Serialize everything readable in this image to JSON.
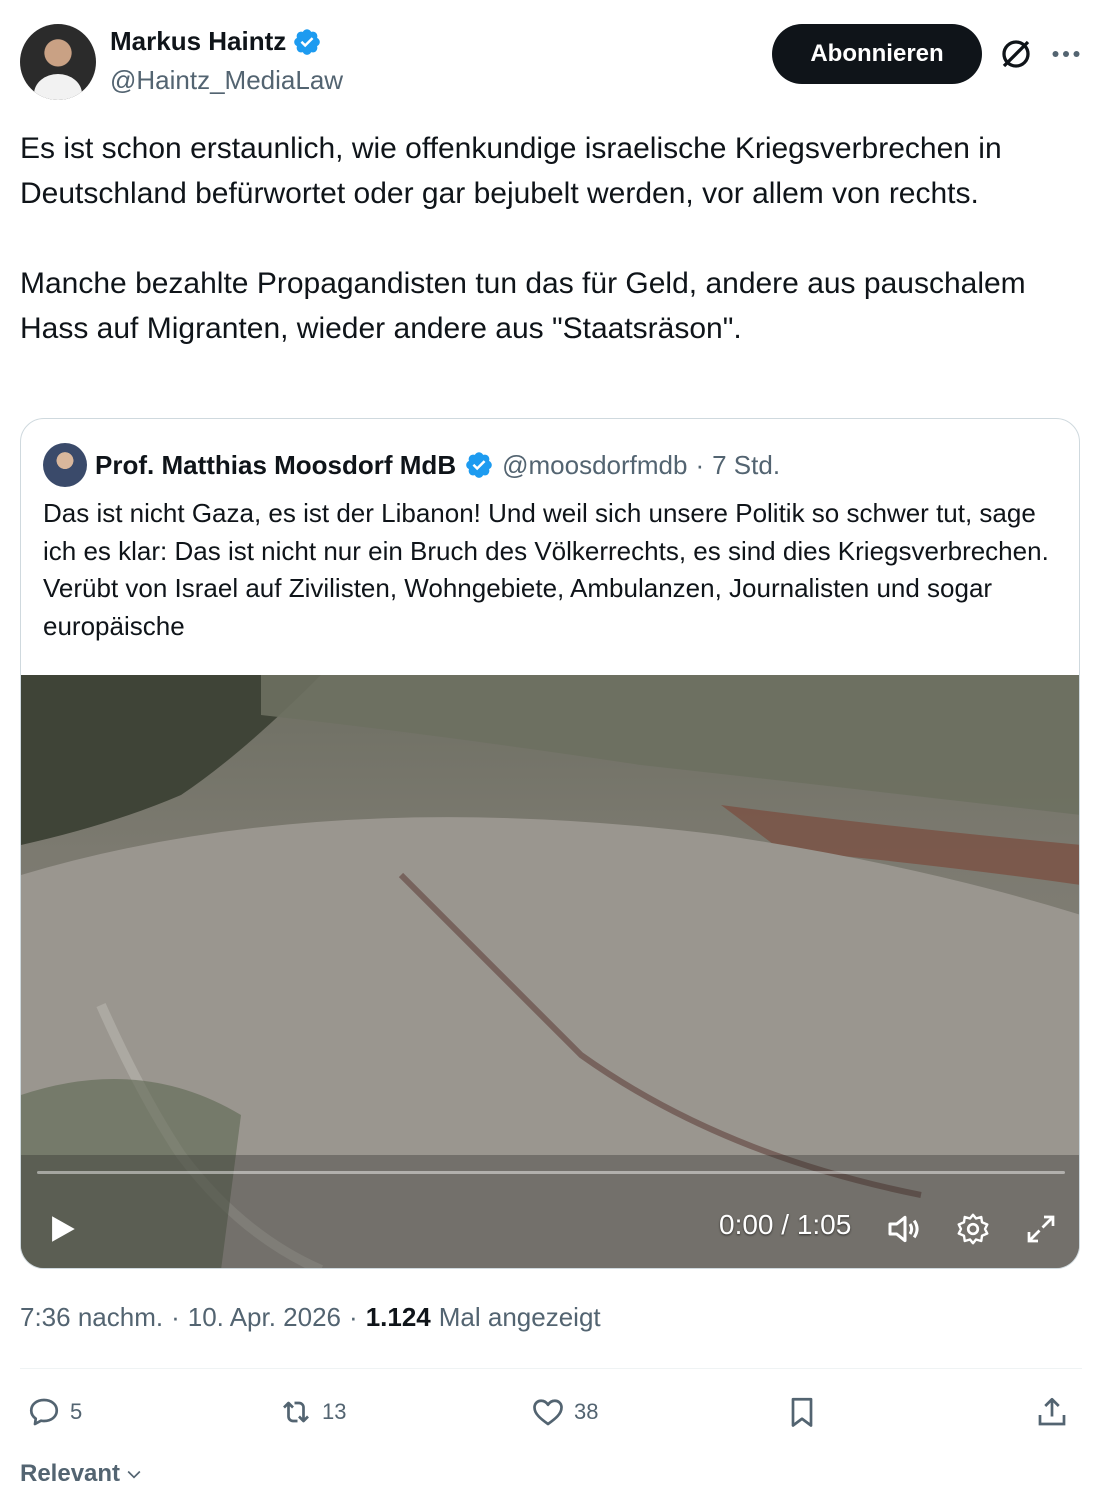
{
  "author": {
    "name": "Markus Haintz",
    "handle": "@Haintz_MediaLaw"
  },
  "header": {
    "subscribe_label": "Abonnieren",
    "grok_icon": "grok-icon",
    "more_icon": "more-icon"
  },
  "tweet": {
    "text": "Es ist schon erstaunlich, wie offenkundige israelische Kriegsverbrechen in Deutschland befürwortet oder gar bejubelt werden, vor allem von rechts.\n\nManche bezahlte Propagandisten tun das für Geld, andere aus pauschalem Hass auf Migranten, wieder andere aus \"Staatsräson\"."
  },
  "quote": {
    "name": "Prof. Matthias Moosdorf MdB",
    "handle": "@moosdorfmdb",
    "separator": "·",
    "time": "7 Std.",
    "text": "Das ist nicht Gaza, es ist der Libanon! Und weil sich unsere Politik so schwer tut, sage ich es klar: Das ist nicht nur ein Bruch des Völkerrechts, es sind dies Kriegsverbrechen. Verübt von Israel auf Zivilisten, Wohngebiete, Ambulanzen, Journalisten und sogar europäische",
    "video": {
      "time": "0:00 / 1:05",
      "progress": 0.0,
      "icons": [
        "play-icon",
        "volume-icon",
        "settings-icon",
        "fullscreen-icon"
      ]
    }
  },
  "meta": {
    "time": "7:36 nachm.",
    "sep1": "·",
    "date": "10. Apr. 2026",
    "sep2": "·",
    "views": "1.124",
    "views_label": "Mal angezeigt"
  },
  "actions": {
    "replies": "5",
    "reposts": "13",
    "likes": "38"
  },
  "sort": {
    "label": "Relevant"
  },
  "colors": {
    "verified": "#1d9bf0",
    "text_secondary": "#536471",
    "text_primary": "#0f1419"
  }
}
